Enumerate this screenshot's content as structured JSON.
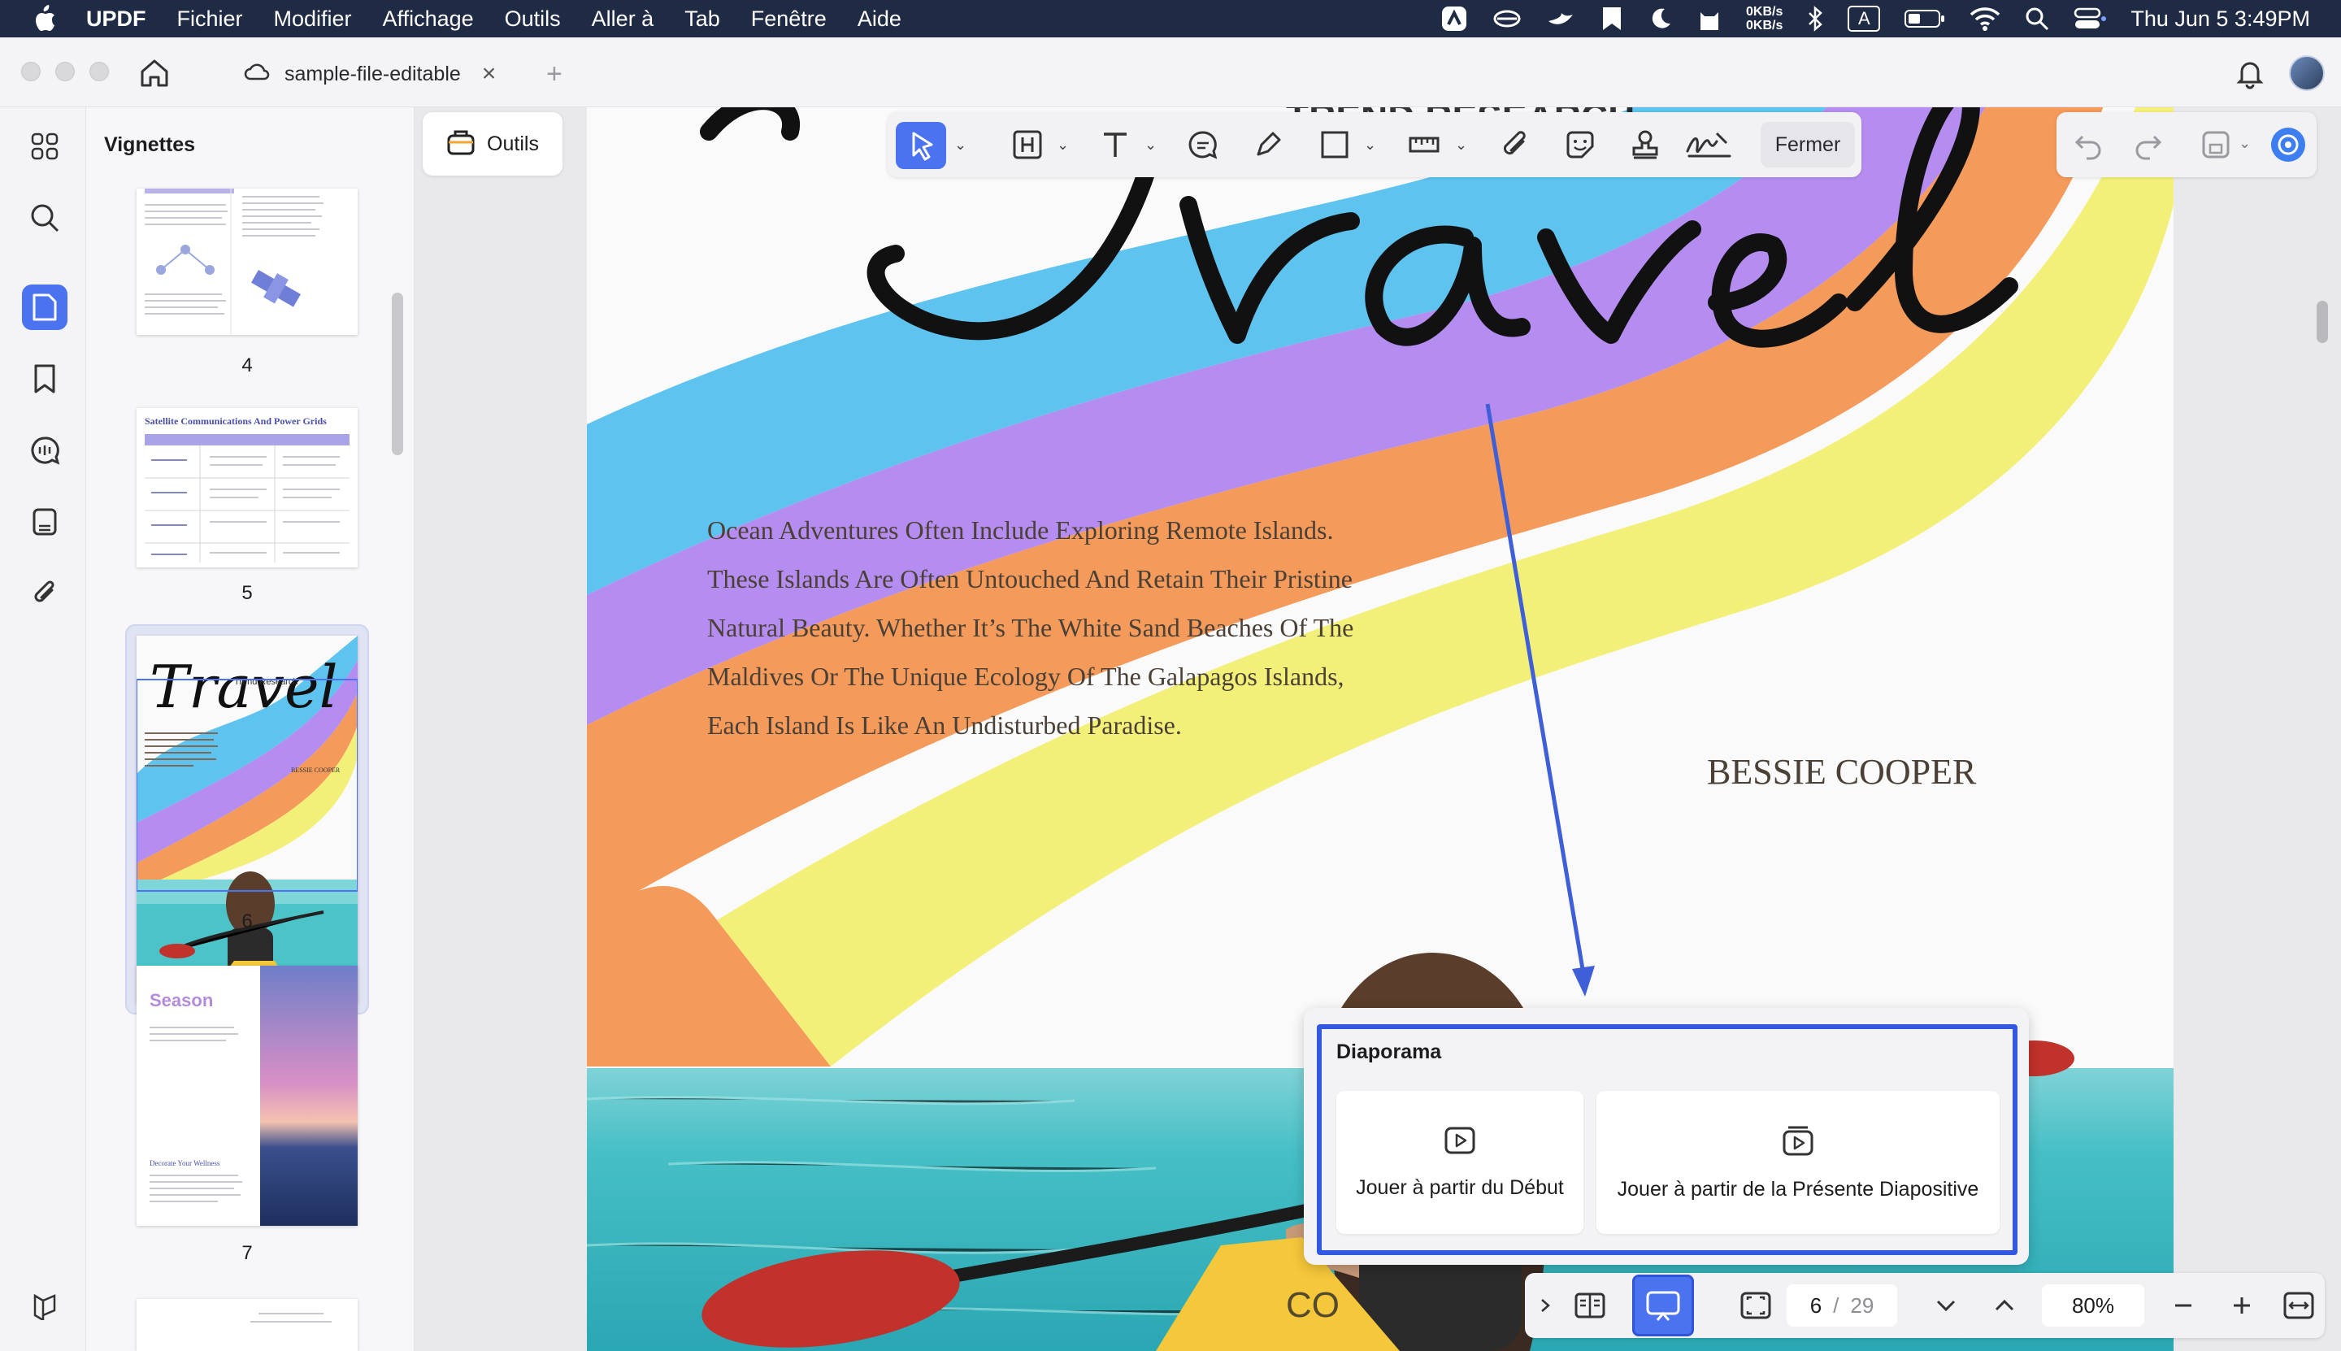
{
  "menubar": {
    "app_name": "UPDF",
    "items": [
      "Fichier",
      "Modifier",
      "Affichage",
      "Outils",
      "Aller à",
      "Tab",
      "Fenêtre",
      "Aide"
    ],
    "net_up": "0KB/s",
    "net_down": "0KB/s",
    "input_source": "A",
    "datetime": "Thu Jun 5  3:49PM"
  },
  "tab": {
    "filename": "sample-file-editable",
    "close_label": "×",
    "new_tab_label": "+"
  },
  "thumbnails": {
    "title": "Vignettes",
    "pages": [
      {
        "number": "4"
      },
      {
        "number": "5",
        "heading": "Satellite Communications And Power Grids"
      },
      {
        "number": "6",
        "heading": "Travel",
        "subheading": "Trend Research",
        "author": "BESSIE COOPER"
      },
      {
        "number": "7",
        "heading": "Season",
        "subheading": "Decorate Your Wellness"
      }
    ]
  },
  "toolbar": {
    "tools_label": "Outils",
    "close_label": "Fermer"
  },
  "document": {
    "title_script": "Travel",
    "body": "Ocean Adventures Often Include Exploring Remote Islands. These Islands Are Often Untouched And Retain Their Pristine Natural Beauty. Whether It’s The White Sand Beaches Of The Maldives Or The Unique Ecology Of The Galapagos Islands, Each Island Is Like An Undisturbed Paradise.",
    "author": "BESSIE COOPER"
  },
  "slideshow_popup": {
    "title": "Diaporama",
    "option_start": "Jouer à partir du Début",
    "option_current": "Jouer à partir de la Présente Diapositive"
  },
  "bottom_bar": {
    "current_page": "6",
    "separator": "/",
    "total_pages": "29",
    "zoom": "80%"
  },
  "colors": {
    "accent": "#4b73f0",
    "highlight": "#3257e0",
    "rainbow_blue": "#5ec3ee",
    "rainbow_purple": "#b58df0",
    "rainbow_orange": "#f49a5a",
    "rainbow_yellow": "#f3f07a",
    "annotation_arrow": "#3e5fd8"
  }
}
